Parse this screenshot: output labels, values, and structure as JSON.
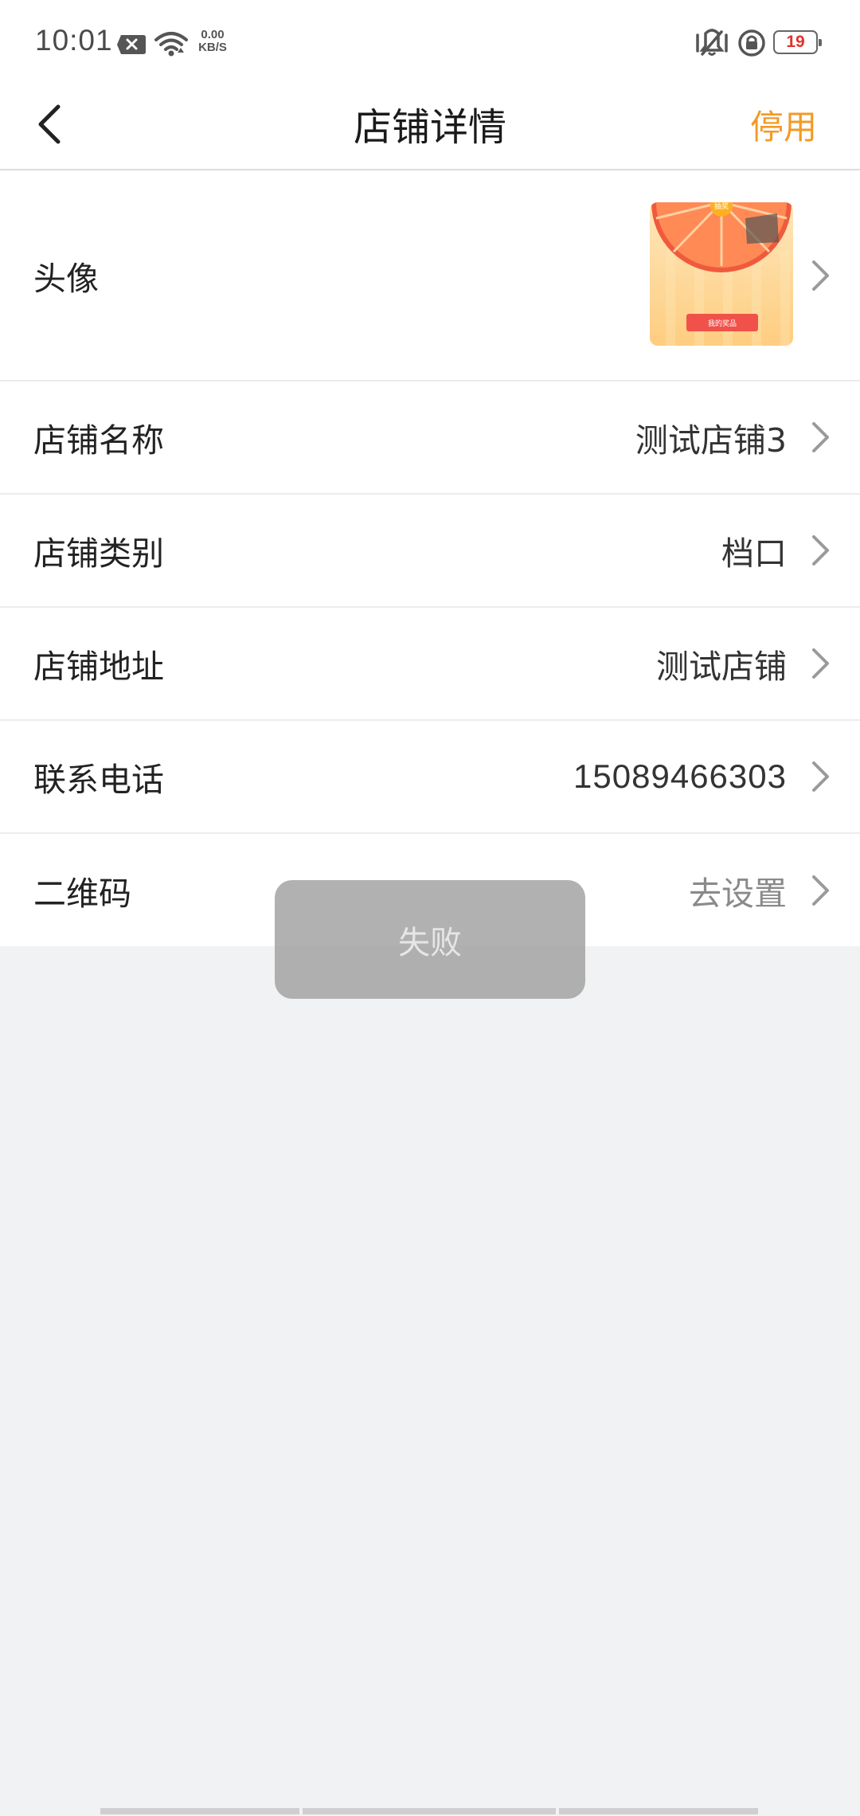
{
  "status_bar": {
    "time": "10:01",
    "net_speed_value": "0.00",
    "net_speed_unit": "KB/S",
    "battery_level": "19",
    "icons": [
      "notification-x-icon",
      "wifi-icon",
      "vibrate-icon",
      "rotation-lock-icon",
      "battery-icon"
    ],
    "battery_color": "#e0322e"
  },
  "nav": {
    "title": "店铺详情",
    "action_label": "停用",
    "action_color": "#f39a25",
    "back_icon": "chevron-left-icon"
  },
  "rows": [
    {
      "label": "头像",
      "value": "",
      "type": "avatar"
    },
    {
      "label": "店铺名称",
      "value": "测试店铺3"
    },
    {
      "label": "店铺类别",
      "value": "档口"
    },
    {
      "label": "店铺地址",
      "value": "测试店铺"
    },
    {
      "label": "联系电话",
      "value": "15089466303"
    },
    {
      "label": "二维码",
      "value": "去设置",
      "muted": true
    }
  ],
  "avatar_image": {
    "button_text": "我的奖品",
    "top_badge_text": "抽奖"
  },
  "toast": {
    "text": "失败"
  }
}
